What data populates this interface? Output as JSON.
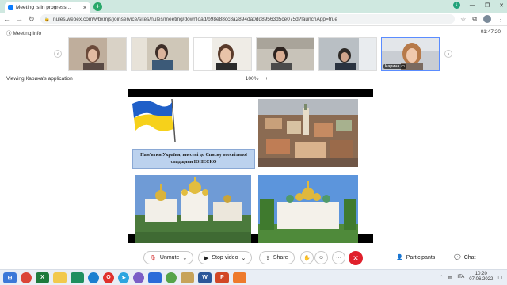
{
  "browser": {
    "tab_title": "Meeting is in progress...",
    "url": "nules.webex.com/wbxmjs/joinservice/sites/nules/meeting/download/b98e88cc8a2894da0dd89563d5ce075d?launchApp=true"
  },
  "meeting": {
    "info_label": "Meeting Info",
    "timer": "01:47:20",
    "participant_label": "Карина",
    "viewing_label": "Viewing Карина's application",
    "zoom_minus": "−",
    "zoom_value": "100%",
    "zoom_plus": "+"
  },
  "slide": {
    "caption_line1": "Пам'ятки України, внесені до Списку всесвітньої",
    "caption_line2": "спадщини ЮНЕСКО"
  },
  "controls": {
    "unmute": "Unmute",
    "stop_video": "Stop video",
    "share": "Share",
    "more": "···",
    "leave": "✕",
    "participants": "Participants",
    "chat": "Chat"
  },
  "taskbar": {
    "lang": "ITA",
    "time": "10:20",
    "date": "07.06.2022"
  }
}
